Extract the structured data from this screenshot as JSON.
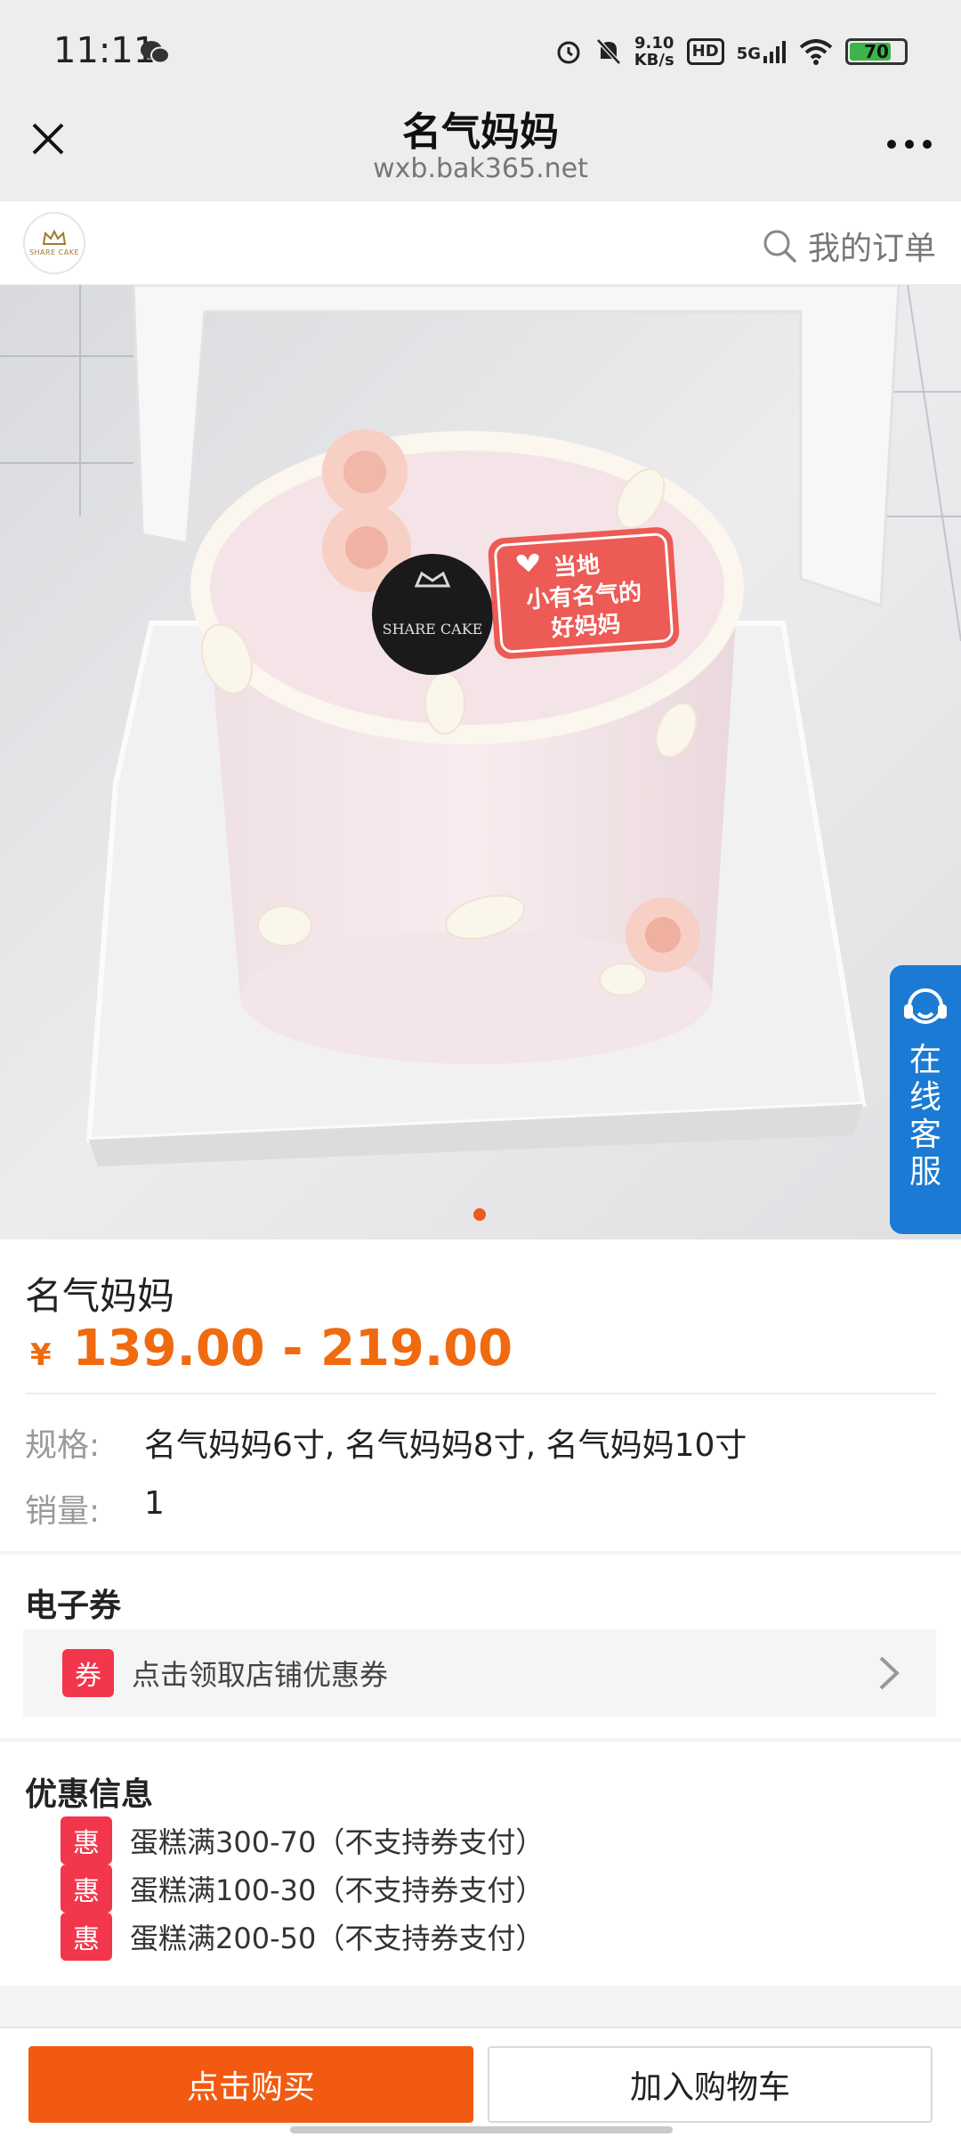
{
  "status_bar": {
    "time": "11:11",
    "net_speed_value": "9.10",
    "net_speed_unit": "KB/s",
    "hd": "HD",
    "network": "5G",
    "battery": "70"
  },
  "titlebar": {
    "title": "名气妈妈",
    "url": "wxb.bak365.net"
  },
  "shop_header": {
    "logo_text": "SHARE CAKE",
    "orders_label": "我的订单"
  },
  "hero": {
    "plaque_lines": [
      "当地",
      "小有名气的",
      "好妈妈"
    ],
    "badge_text": "SHARE CAKE",
    "customer_service_label": "在线客服"
  },
  "product": {
    "name": "名气妈妈",
    "currency": "¥",
    "price_range": "139.00 - 219.00",
    "spec_label": "规格:",
    "spec_value": "名气妈妈6寸, 名气妈妈8寸, 名气妈妈10寸",
    "sales_label": "销量:",
    "sales_value": "1"
  },
  "coupon": {
    "title": "电子券",
    "tag": "券",
    "text": "点击领取店铺优惠券"
  },
  "promo": {
    "title": "优惠信息",
    "tag": "惠",
    "items": [
      "蛋糕满300-70（不支持券支付）",
      "蛋糕满100-30（不支持券支付）",
      "蛋糕满200-50（不支持券支付）"
    ]
  },
  "bottom_bar": {
    "buy_label": "点击购买",
    "cart_label": "加入购物车"
  },
  "colors": {
    "accent_orange": "#f15a10",
    "tag_red": "#f2364c",
    "service_blue": "#1a7ad4"
  }
}
